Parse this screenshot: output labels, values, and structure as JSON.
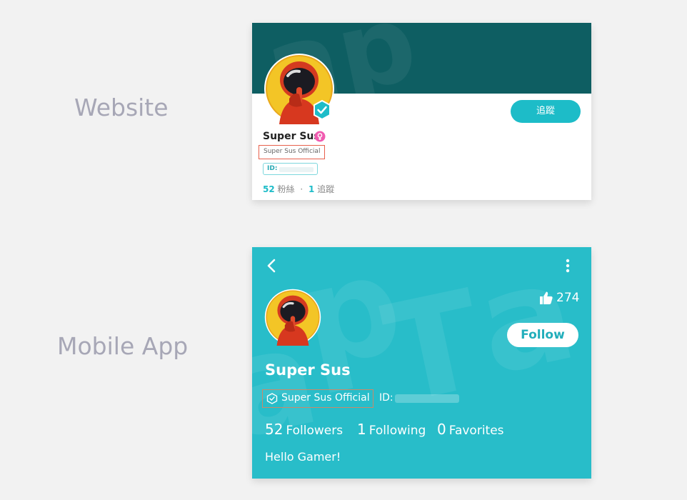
{
  "labels": {
    "website": "Website",
    "mobile_app": "Mobile App"
  },
  "website": {
    "name": "Super Sus",
    "official_tag": "Super Sus Official",
    "id_label": "ID:",
    "follow_button": "追蹤",
    "followers_count": "52",
    "followers_label": "粉絲",
    "separator": "·",
    "following_count": "1",
    "following_label": "追蹤",
    "colors": {
      "banner": "#0e5e62",
      "accent": "#1dbcc8",
      "highlight_box": "#e8604c"
    }
  },
  "mobile": {
    "name": "Super Sus",
    "official_tag": "Super Sus Official",
    "id_label": "ID:",
    "likes": "274",
    "follow_button": "Follow",
    "followers_count": "52",
    "followers_label": "Followers",
    "following_count": "1",
    "following_label": "Following",
    "favorites_count": "0",
    "favorites_label": "Favorites",
    "bio": "Hello Gamer!",
    "colors": {
      "background": "#28bdc9"
    }
  },
  "icons": {
    "back": "chevron-left-icon",
    "more": "more-vertical-icon",
    "like": "thumbs-up-icon",
    "verified": "verified-check-icon",
    "gender": "female-icon",
    "official": "official-shield-icon"
  }
}
